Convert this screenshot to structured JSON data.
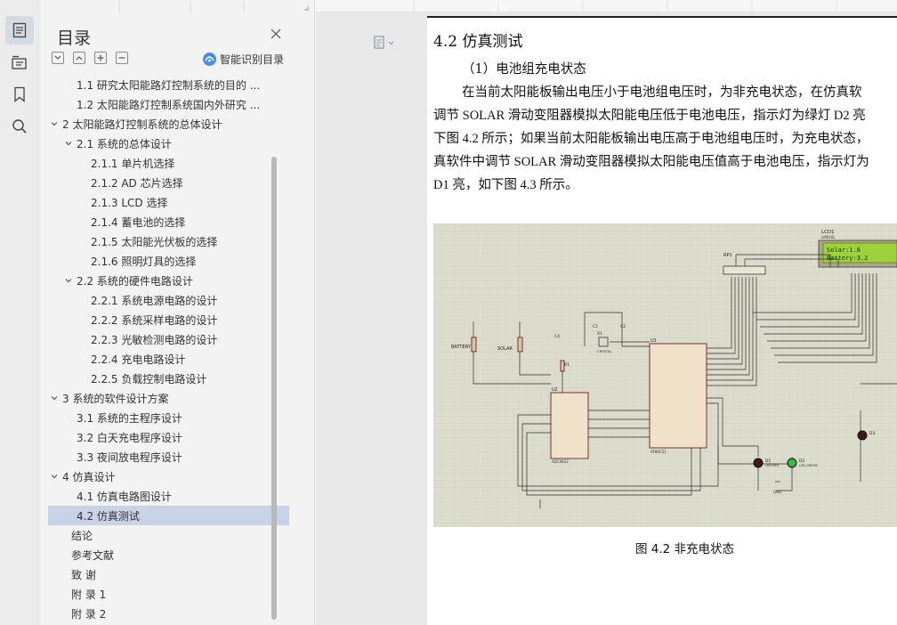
{
  "sidebar_rail": {
    "icons": [
      "toc-icon",
      "outline-icon",
      "bookmark-icon",
      "search-icon"
    ]
  },
  "toc": {
    "title": "目录",
    "smart_label": "智能识别目录",
    "items": [
      {
        "label": "1.1 研究太阳能路灯控制系统的目的 ...",
        "level": 2,
        "expand": ""
      },
      {
        "label": "1.2 太阳能路灯控制系统国内外研究 ...",
        "level": 2,
        "expand": ""
      },
      {
        "label": "2 太阳能路灯控制系统的总体设计",
        "level": 1,
        "expand": "open"
      },
      {
        "label": "2.1  系统的总体设计",
        "level": 2,
        "expand": "open"
      },
      {
        "label": "2.1.1  单片机选择",
        "level": 3,
        "expand": ""
      },
      {
        "label": "2.1.2 AD 芯片选择",
        "level": 3,
        "expand": ""
      },
      {
        "label": "2.1.3 LCD 选择",
        "level": 3,
        "expand": ""
      },
      {
        "label": "2.1.4  蓄电池的选择",
        "level": 3,
        "expand": ""
      },
      {
        "label": "2.1.5 太阳能光伏板的选择",
        "level": 3,
        "expand": ""
      },
      {
        "label": "2.1.6 照明灯具的选择",
        "level": 3,
        "expand": ""
      },
      {
        "label": "2.2 系统的硬件电路设计",
        "level": 2,
        "expand": "open"
      },
      {
        "label": "2.2.1 系统电源电路的设计",
        "level": 3,
        "expand": ""
      },
      {
        "label": "2.2.2 系统采样电路的设计",
        "level": 3,
        "expand": ""
      },
      {
        "label": "2.2.3 光敏检测电路的设计",
        "level": 3,
        "expand": ""
      },
      {
        "label": "2.2.4 充电电路设计",
        "level": 3,
        "expand": ""
      },
      {
        "label": "2.2.5 负载控制电路设计",
        "level": 3,
        "expand": ""
      },
      {
        "label": "3 系统的软件设计方案",
        "level": 1,
        "expand": "open"
      },
      {
        "label": "3.1  系统的主程序设计",
        "level": 2,
        "expand": ""
      },
      {
        "label": "3.2 白天充电程序设计",
        "level": 2,
        "expand": ""
      },
      {
        "label": "3.3 夜间放电程序设计",
        "level": 2,
        "expand": ""
      },
      {
        "label": "4 仿真设计",
        "level": 1,
        "expand": "open"
      },
      {
        "label": "4.1 仿真电路图设计",
        "level": 2,
        "expand": ""
      },
      {
        "label": "4.2  仿真测试",
        "level": 2,
        "expand": "",
        "selected": true
      },
      {
        "label": "结论",
        "level": 1,
        "expand": "none"
      },
      {
        "label": "参考文献",
        "level": 0,
        "expand": ""
      },
      {
        "label": "致    谢",
        "level": 0,
        "expand": ""
      },
      {
        "label": "附    录 1",
        "level": 0,
        "expand": ""
      },
      {
        "label": "附    录 2",
        "level": 0,
        "expand": ""
      }
    ]
  },
  "document": {
    "heading": "4.2  仿真测试",
    "subheading": "（1）电池组充电状态",
    "lines": [
      "在当前太阳能板输出电压小于电池组电压时，为非充电状态，在仿真软",
      "调节 SOLAR 滑动变阻器模拟太阳能电压低于电池电压，指示灯为绿灯 D2 亮",
      "下图 4.2 所示；如果当前太阳能板输出电压高于电池组电压时，为充电状态，",
      "真软件中调节 SOLAR 滑动变阻器模拟太阳能电压值高于电池电压，指示灯为",
      "D1 亮，如下图 4.3 所示。"
    ],
    "caption": "图 4.2  非充电状态",
    "figure": {
      "lcd_name": "LCD1",
      "lcd_model": "LM016L",
      "lcd_line1": "Solar:1.6",
      "lcd_line2": "Battery:3.2",
      "rp_name": "RP1",
      "battery_label": "BATTERY",
      "solar_label": "SOLAR",
      "mcu_name": "U1",
      "mcu_model": "AT89C51",
      "adc_name": "U2",
      "adc_model": "ADC0832",
      "crystal_label": "CRYSTAL",
      "c1_label": "C1",
      "c2_label": "C2",
      "c4_label": "C4",
      "r1_label": "R1",
      "x1_label": "X1",
      "d1_label": "D1",
      "d2_label": "D2",
      "d3_label": "D3",
      "d1_color": "LED-RED",
      "d2_color": "LED-GREEN",
      "gnd_label": "GND"
    }
  }
}
